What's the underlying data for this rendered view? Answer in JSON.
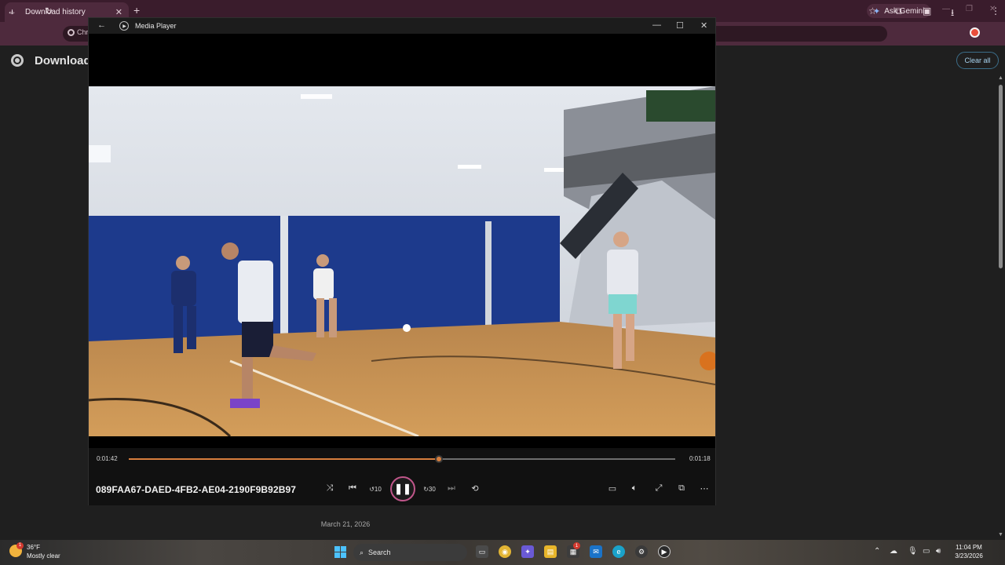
{
  "browser": {
    "tab_title": "Download history",
    "tab_icon": "download-icon",
    "new_tab": "+",
    "ask_gemini": "Ask Gemini",
    "omnibox_text": "Chr",
    "icons": [
      "back-icon",
      "forward-icon",
      "reload-icon",
      "star-icon",
      "extensions-icon",
      "sidepanel-icon",
      "download-icon",
      "menu-icon"
    ]
  },
  "page": {
    "title": "Download",
    "clear_all": "Clear all",
    "date_label": "March 21, 2026"
  },
  "media_player": {
    "title": "Media Player",
    "elapsed": "0:01:42",
    "remaining": "0:01:18",
    "progress_percent": 56.7,
    "media_name": "089FAA67-DAED-4FB2-AE04-2190F9B92B97",
    "skip_back_label": "10",
    "skip_forward_label": "30",
    "accent_color": "#d87f3e",
    "state": "playing"
  },
  "taskbar": {
    "weather_temp": "36°F",
    "weather_condition": "Mostly clear",
    "weather_badge": "1",
    "search_placeholder": "Search",
    "time": "11:04 PM",
    "date": "3/23/2026",
    "notification_badge": "1"
  }
}
